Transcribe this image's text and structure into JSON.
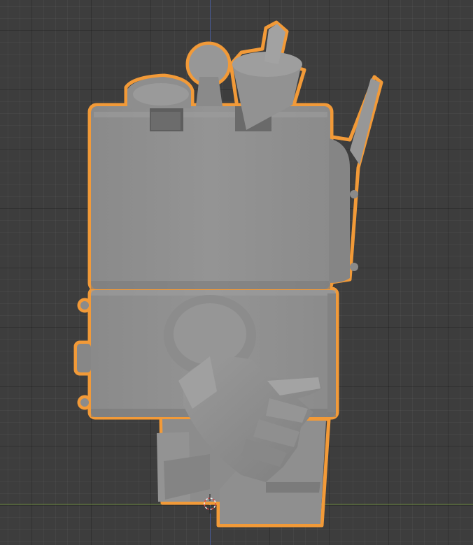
{
  "viewport": {
    "background_color": "#3d3d3d",
    "grid_color": "#303030",
    "axis_x_color": "#6b8a3a",
    "axis_z_color": "#4a5fa0",
    "selection_outline_color": "#f29a38",
    "mesh_color": "#8e8e8e",
    "mesh_shadow_color": "#6f6f6f",
    "mesh_highlight_color": "#a6a6a6"
  },
  "icons": {
    "origin": "3d-cursor-icon"
  }
}
